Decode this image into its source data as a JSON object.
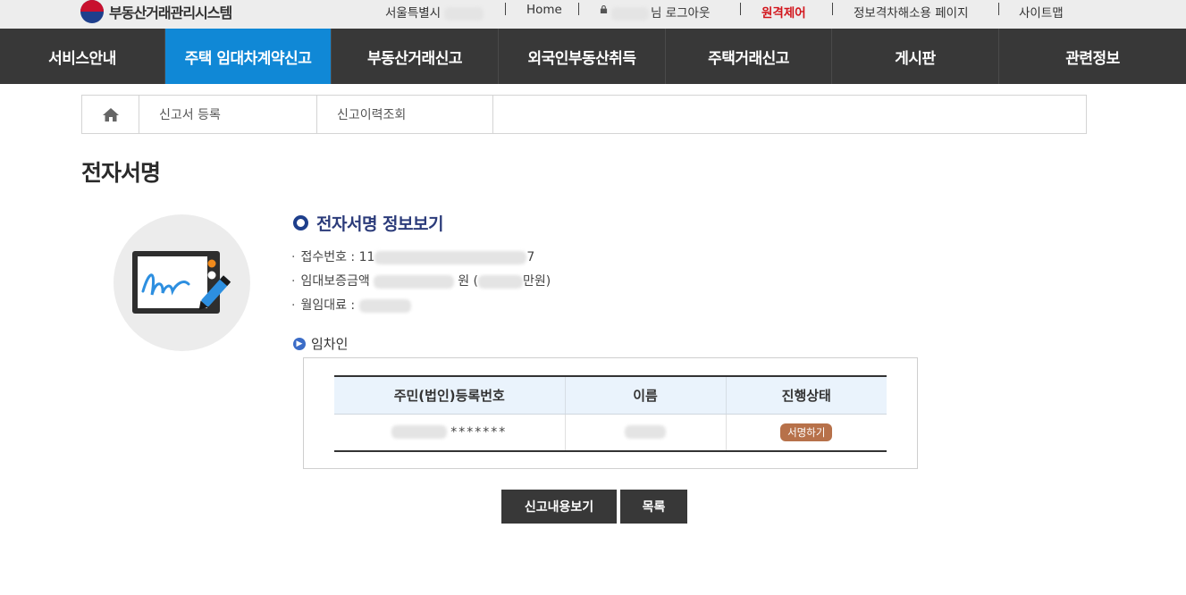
{
  "header": {
    "logo_text": "부동산거래관리시스템",
    "user_region": "서울특별시",
    "home_label": "Home",
    "logout_label": "님 로그아웃",
    "remote_label": "원격제어",
    "info_page_label": "정보격차해소용 페이지",
    "sitemap_label": "사이트맵"
  },
  "nav": {
    "items": [
      {
        "label": "서비스안내"
      },
      {
        "label": "주택 임대차계약신고"
      },
      {
        "label": "부동산거래신고"
      },
      {
        "label": "외국인부동산취득"
      },
      {
        "label": "주택거래신고"
      },
      {
        "label": "게시판"
      },
      {
        "label": "관련정보"
      }
    ]
  },
  "subtabs": {
    "items": [
      {
        "label": "신고서 등록"
      },
      {
        "label": "신고이력조회"
      }
    ]
  },
  "page": {
    "title": "전자서명"
  },
  "info": {
    "heading": "전자서명 정보보기",
    "receipt_label": "접수번호 : ",
    "receipt_prefix": "11",
    "receipt_suffix": "7",
    "deposit_label": "임대보증금액 ",
    "deposit_unit": "원 (",
    "deposit_unit2": "만원)",
    "monthly_label": "월임대료 : "
  },
  "tenant": {
    "heading": "임차인",
    "columns": [
      "주민(법인)등록번호",
      "이름",
      "진행상태"
    ],
    "rows": [
      {
        "reg_no_suffix": "*******",
        "status_button": "서명하기"
      }
    ]
  },
  "actions": {
    "view_report_label": "신고내용보기",
    "list_label": "목록"
  },
  "colors": {
    "nav_bg": "#383838",
    "nav_active": "#1088d6",
    "accent_red": "#d2141b",
    "heading_blue": "#2b3b7a",
    "badge_brown": "#b7714a"
  },
  "icons": {
    "logo": "taegeuk-logo-icon",
    "home": "home-icon",
    "lock": "lock-icon",
    "illustration": "e-signature-tablet-icon"
  }
}
